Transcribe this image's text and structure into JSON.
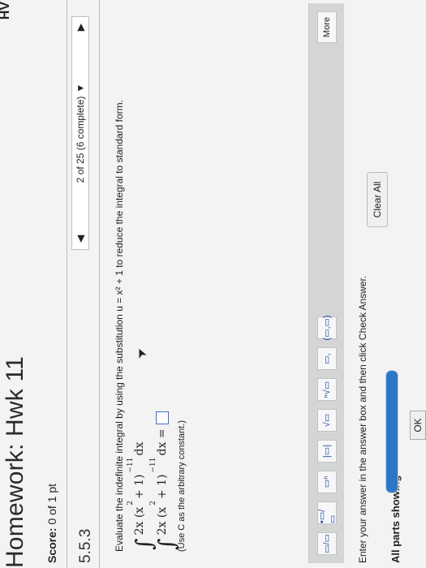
{
  "header": {
    "title": "Homework: Hwk 11",
    "right_tag": "HV",
    "score_label": "Score:",
    "score_value": "0 of 1 pt"
  },
  "question": {
    "id": "5.5.3",
    "nav_text": "2 of 25 (6 complete)",
    "instruction": "Evaluate the indefinite integral by using the substitution u = x² + 1 to reduce the integral to standard form.",
    "integral_display": {
      "prefix": "2x (x",
      "power2": "2",
      "middle": " + 1)",
      "exponent": "−11",
      "suffix": "dx"
    },
    "answer_line": {
      "prefix": "2x (x",
      "power2": "2",
      "middle": " + 1)",
      "exponent": "−11",
      "suffix": "dx ="
    },
    "hint": "(Use C as the arbitrary constant.)"
  },
  "toolbar": {
    "tools": [
      {
        "name": "fraction-tool",
        "glyph": "▭/▭"
      },
      {
        "name": "mixed-number-tool",
        "glyph": "▪▭/▭"
      },
      {
        "name": "exponent-tool",
        "glyph": "▭ⁿ"
      },
      {
        "name": "absolute-value-tool",
        "glyph": "|▭|"
      },
      {
        "name": "square-root-tool",
        "glyph": "√▭"
      },
      {
        "name": "nth-root-tool",
        "glyph": "ⁿ√▭"
      },
      {
        "name": "subscript-tool",
        "glyph": "▭,"
      },
      {
        "name": "parentheses-tool",
        "glyph": "(▭,▭)"
      }
    ],
    "more_label": "More"
  },
  "footer": {
    "enter_text": "Enter your answer in the answer box and then click Check Answer.",
    "parts_label": "All parts showing",
    "progress_fraction": 1.0,
    "clear_all_label": "Clear All",
    "ok_label": "OK"
  }
}
